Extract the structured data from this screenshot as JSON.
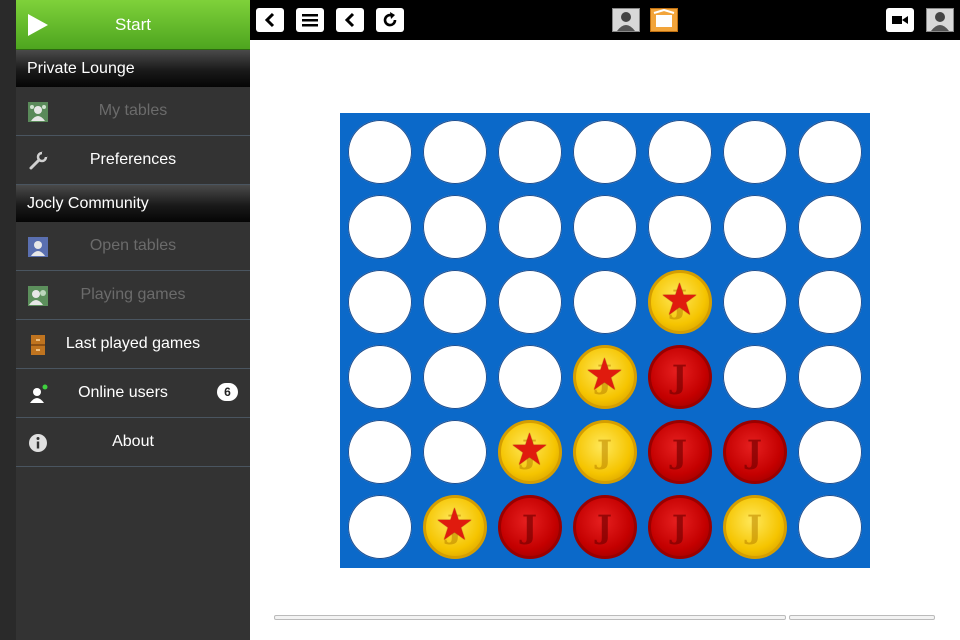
{
  "sidebar": {
    "start_label": "Start",
    "sections": [
      {
        "title": "Private Lounge",
        "items": [
          {
            "label": "My tables",
            "icon": "my-tables-icon",
            "enabled": false
          },
          {
            "label": "Preferences",
            "icon": "wrench-icon",
            "enabled": true
          }
        ]
      },
      {
        "title": "Jocly Community",
        "items": [
          {
            "label": "Open tables",
            "icon": "open-tables-icon",
            "enabled": false
          },
          {
            "label": "Playing games",
            "icon": "playing-games-icon",
            "enabled": false
          },
          {
            "label": "Last played games",
            "icon": "cabinet-icon",
            "enabled": true
          },
          {
            "label": "Online users",
            "icon": "online-user-icon",
            "enabled": true,
            "badge": "6"
          },
          {
            "label": "About",
            "icon": "info-icon",
            "enabled": true
          }
        ]
      }
    ]
  },
  "toolbar": {
    "left_buttons": [
      "back-icon",
      "menu-icon",
      "previous-icon",
      "refresh-icon"
    ],
    "center_icons": [
      "player-avatar-icon",
      "game-icon"
    ],
    "right_icons": [
      "video-camera-icon",
      "player-avatar-icon"
    ]
  },
  "board": {
    "columns": 7,
    "rows": 6,
    "cells": [
      [
        "empty",
        "empty",
        "empty",
        "empty",
        "empty",
        "empty",
        "empty"
      ],
      [
        "empty",
        "empty",
        "empty",
        "empty",
        "empty",
        "empty",
        "empty"
      ],
      [
        "empty",
        "empty",
        "empty",
        "empty",
        "yellow-star",
        "empty",
        "empty"
      ],
      [
        "empty",
        "empty",
        "empty",
        "yellow-star",
        "red",
        "empty",
        "empty"
      ],
      [
        "empty",
        "empty",
        "yellow-star",
        "yellow",
        "red",
        "red",
        "empty"
      ],
      [
        "empty",
        "yellow-star",
        "red",
        "red",
        "red",
        "yellow",
        "empty"
      ]
    ],
    "colors": {
      "board": "#0b69c9",
      "yellow": "#f5c400",
      "red": "#c40000",
      "accent": "#5cb82a"
    }
  }
}
